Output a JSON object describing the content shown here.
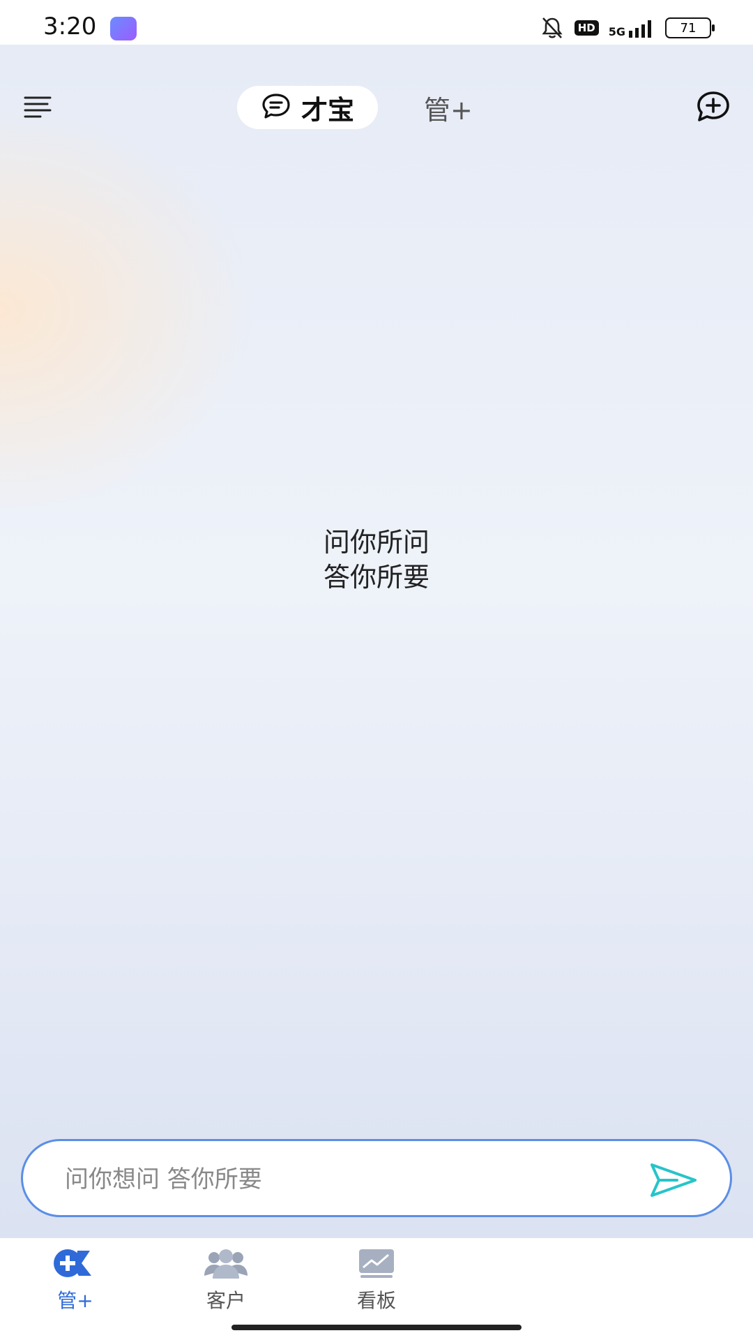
{
  "status_bar": {
    "time": "3:20",
    "network": "5G",
    "hd_label": "HD",
    "battery": "71"
  },
  "header": {
    "tabs": [
      {
        "label": "才宝",
        "active": true,
        "icon": "chat-bubble-icon"
      },
      {
        "label": "管+",
        "active": false
      }
    ]
  },
  "hero": {
    "line1": "问你所问",
    "line2": "答你所要"
  },
  "input": {
    "placeholder": "问你想问 答你所要",
    "value": ""
  },
  "bottom_nav": {
    "items": [
      {
        "label": "管+",
        "icon": "guan-plus-logo-icon",
        "active": true
      },
      {
        "label": "客户",
        "icon": "people-icon",
        "active": false
      },
      {
        "label": "看板",
        "icon": "dashboard-chart-icon",
        "active": false
      }
    ]
  },
  "colors": {
    "accent": "#2f6ad8",
    "input_border": "#5b8ee6",
    "send": "#27c4c9"
  }
}
